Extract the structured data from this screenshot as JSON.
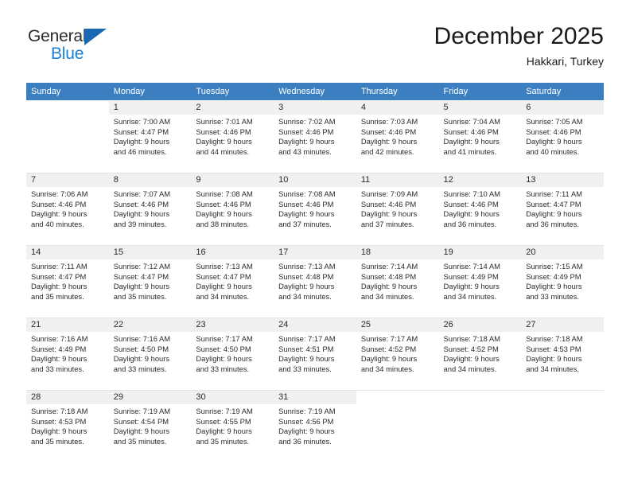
{
  "brand": {
    "name_top": "General",
    "name_bottom": "Blue",
    "triangle_color": "#1b68b3",
    "blue_text_color": "#1b7fd4"
  },
  "header": {
    "title": "December 2025",
    "subtitle": "Hakkari, Turkey"
  },
  "theme": {
    "header_row_bg": "#3c7fc1",
    "header_row_text": "#ffffff",
    "daynum_shaded_bg": "#f0f0f0",
    "body_text": "#2b2b2b"
  },
  "weekdays": [
    "Sunday",
    "Monday",
    "Tuesday",
    "Wednesday",
    "Thursday",
    "Friday",
    "Saturday"
  ],
  "weeks": [
    [
      {
        "day": "",
        "sunrise": "",
        "sunset": "",
        "daylight_1": "",
        "daylight_2": "",
        "empty": true
      },
      {
        "day": "1",
        "sunrise": "Sunrise: 7:00 AM",
        "sunset": "Sunset: 4:47 PM",
        "daylight_1": "Daylight: 9 hours",
        "daylight_2": "and 46 minutes."
      },
      {
        "day": "2",
        "sunrise": "Sunrise: 7:01 AM",
        "sunset": "Sunset: 4:46 PM",
        "daylight_1": "Daylight: 9 hours",
        "daylight_2": "and 44 minutes."
      },
      {
        "day": "3",
        "sunrise": "Sunrise: 7:02 AM",
        "sunset": "Sunset: 4:46 PM",
        "daylight_1": "Daylight: 9 hours",
        "daylight_2": "and 43 minutes."
      },
      {
        "day": "4",
        "sunrise": "Sunrise: 7:03 AM",
        "sunset": "Sunset: 4:46 PM",
        "daylight_1": "Daylight: 9 hours",
        "daylight_2": "and 42 minutes."
      },
      {
        "day": "5",
        "sunrise": "Sunrise: 7:04 AM",
        "sunset": "Sunset: 4:46 PM",
        "daylight_1": "Daylight: 9 hours",
        "daylight_2": "and 41 minutes."
      },
      {
        "day": "6",
        "sunrise": "Sunrise: 7:05 AM",
        "sunset": "Sunset: 4:46 PM",
        "daylight_1": "Daylight: 9 hours",
        "daylight_2": "and 40 minutes."
      }
    ],
    [
      {
        "day": "7",
        "sunrise": "Sunrise: 7:06 AM",
        "sunset": "Sunset: 4:46 PM",
        "daylight_1": "Daylight: 9 hours",
        "daylight_2": "and 40 minutes."
      },
      {
        "day": "8",
        "sunrise": "Sunrise: 7:07 AM",
        "sunset": "Sunset: 4:46 PM",
        "daylight_1": "Daylight: 9 hours",
        "daylight_2": "and 39 minutes."
      },
      {
        "day": "9",
        "sunrise": "Sunrise: 7:08 AM",
        "sunset": "Sunset: 4:46 PM",
        "daylight_1": "Daylight: 9 hours",
        "daylight_2": "and 38 minutes."
      },
      {
        "day": "10",
        "sunrise": "Sunrise: 7:08 AM",
        "sunset": "Sunset: 4:46 PM",
        "daylight_1": "Daylight: 9 hours",
        "daylight_2": "and 37 minutes."
      },
      {
        "day": "11",
        "sunrise": "Sunrise: 7:09 AM",
        "sunset": "Sunset: 4:46 PM",
        "daylight_1": "Daylight: 9 hours",
        "daylight_2": "and 37 minutes."
      },
      {
        "day": "12",
        "sunrise": "Sunrise: 7:10 AM",
        "sunset": "Sunset: 4:46 PM",
        "daylight_1": "Daylight: 9 hours",
        "daylight_2": "and 36 minutes."
      },
      {
        "day": "13",
        "sunrise": "Sunrise: 7:11 AM",
        "sunset": "Sunset: 4:47 PM",
        "daylight_1": "Daylight: 9 hours",
        "daylight_2": "and 36 minutes."
      }
    ],
    [
      {
        "day": "14",
        "sunrise": "Sunrise: 7:11 AM",
        "sunset": "Sunset: 4:47 PM",
        "daylight_1": "Daylight: 9 hours",
        "daylight_2": "and 35 minutes."
      },
      {
        "day": "15",
        "sunrise": "Sunrise: 7:12 AM",
        "sunset": "Sunset: 4:47 PM",
        "daylight_1": "Daylight: 9 hours",
        "daylight_2": "and 35 minutes."
      },
      {
        "day": "16",
        "sunrise": "Sunrise: 7:13 AM",
        "sunset": "Sunset: 4:47 PM",
        "daylight_1": "Daylight: 9 hours",
        "daylight_2": "and 34 minutes."
      },
      {
        "day": "17",
        "sunrise": "Sunrise: 7:13 AM",
        "sunset": "Sunset: 4:48 PM",
        "daylight_1": "Daylight: 9 hours",
        "daylight_2": "and 34 minutes."
      },
      {
        "day": "18",
        "sunrise": "Sunrise: 7:14 AM",
        "sunset": "Sunset: 4:48 PM",
        "daylight_1": "Daylight: 9 hours",
        "daylight_2": "and 34 minutes."
      },
      {
        "day": "19",
        "sunrise": "Sunrise: 7:14 AM",
        "sunset": "Sunset: 4:49 PM",
        "daylight_1": "Daylight: 9 hours",
        "daylight_2": "and 34 minutes."
      },
      {
        "day": "20",
        "sunrise": "Sunrise: 7:15 AM",
        "sunset": "Sunset: 4:49 PM",
        "daylight_1": "Daylight: 9 hours",
        "daylight_2": "and 33 minutes."
      }
    ],
    [
      {
        "day": "21",
        "sunrise": "Sunrise: 7:16 AM",
        "sunset": "Sunset: 4:49 PM",
        "daylight_1": "Daylight: 9 hours",
        "daylight_2": "and 33 minutes."
      },
      {
        "day": "22",
        "sunrise": "Sunrise: 7:16 AM",
        "sunset": "Sunset: 4:50 PM",
        "daylight_1": "Daylight: 9 hours",
        "daylight_2": "and 33 minutes."
      },
      {
        "day": "23",
        "sunrise": "Sunrise: 7:17 AM",
        "sunset": "Sunset: 4:50 PM",
        "daylight_1": "Daylight: 9 hours",
        "daylight_2": "and 33 minutes."
      },
      {
        "day": "24",
        "sunrise": "Sunrise: 7:17 AM",
        "sunset": "Sunset: 4:51 PM",
        "daylight_1": "Daylight: 9 hours",
        "daylight_2": "and 33 minutes."
      },
      {
        "day": "25",
        "sunrise": "Sunrise: 7:17 AM",
        "sunset": "Sunset: 4:52 PM",
        "daylight_1": "Daylight: 9 hours",
        "daylight_2": "and 34 minutes."
      },
      {
        "day": "26",
        "sunrise": "Sunrise: 7:18 AM",
        "sunset": "Sunset: 4:52 PM",
        "daylight_1": "Daylight: 9 hours",
        "daylight_2": "and 34 minutes."
      },
      {
        "day": "27",
        "sunrise": "Sunrise: 7:18 AM",
        "sunset": "Sunset: 4:53 PM",
        "daylight_1": "Daylight: 9 hours",
        "daylight_2": "and 34 minutes."
      }
    ],
    [
      {
        "day": "28",
        "sunrise": "Sunrise: 7:18 AM",
        "sunset": "Sunset: 4:53 PM",
        "daylight_1": "Daylight: 9 hours",
        "daylight_2": "and 35 minutes."
      },
      {
        "day": "29",
        "sunrise": "Sunrise: 7:19 AM",
        "sunset": "Sunset: 4:54 PM",
        "daylight_1": "Daylight: 9 hours",
        "daylight_2": "and 35 minutes."
      },
      {
        "day": "30",
        "sunrise": "Sunrise: 7:19 AM",
        "sunset": "Sunset: 4:55 PM",
        "daylight_1": "Daylight: 9 hours",
        "daylight_2": "and 35 minutes."
      },
      {
        "day": "31",
        "sunrise": "Sunrise: 7:19 AM",
        "sunset": "Sunset: 4:56 PM",
        "daylight_1": "Daylight: 9 hours",
        "daylight_2": "and 36 minutes."
      },
      {
        "day": "",
        "sunrise": "",
        "sunset": "",
        "daylight_1": "",
        "daylight_2": "",
        "empty": true
      },
      {
        "day": "",
        "sunrise": "",
        "sunset": "",
        "daylight_1": "",
        "daylight_2": "",
        "empty": true
      },
      {
        "day": "",
        "sunrise": "",
        "sunset": "",
        "daylight_1": "",
        "daylight_2": "",
        "empty": true
      }
    ]
  ]
}
